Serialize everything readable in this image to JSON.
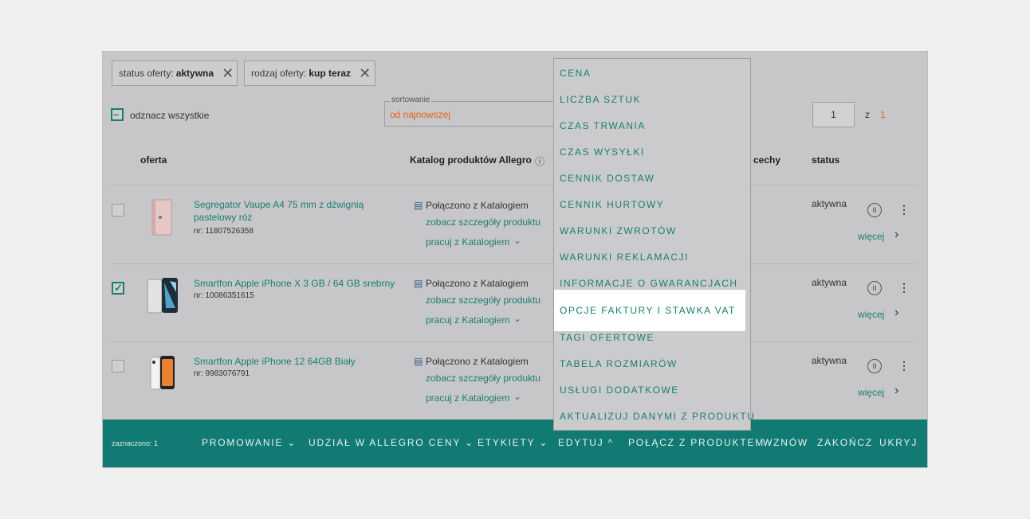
{
  "filters": [
    {
      "label": "status oferty:",
      "value": "aktywna"
    },
    {
      "label": "rodzaj oferty:",
      "value": "kup teraz"
    }
  ],
  "select_all_label": "odznacz wszystkie",
  "sort": {
    "label": "sortowanie",
    "value": "od najnowszej"
  },
  "pagination": {
    "current": "1",
    "of_label": "z",
    "total": "1"
  },
  "columns": {
    "offer": "oferta",
    "catalog": "Katalog produktów Allegro",
    "features": "cechy",
    "status": "status"
  },
  "offers": [
    {
      "title_line1": "Segregator Vaupe A4 75 mm z dźwignią",
      "title_line2": "pastelowy róż",
      "number": "nr: 11807526358",
      "catalog_status": "Połączono z Katalogiem",
      "details_link": "zobacz szczegóły produktu",
      "work_link": "pracuj z Katalogiem",
      "status": "aktywna",
      "more": "więcej",
      "checked": false
    },
    {
      "title_line1": "Smartfon Apple iPhone X 3 GB / 64 GB srebrny",
      "title_line2": "",
      "number": "nr: 10086351615",
      "catalog_status": "Połączono z Katalogiem",
      "details_link": "zobacz szczegóły produktu",
      "work_link": "pracuj z Katalogiem",
      "status": "aktywna",
      "more": "więcej",
      "checked": true
    },
    {
      "title_line1": "Smartfon Apple iPhone 12 64GB Biały",
      "title_line2": "",
      "number": "nr: 9983076791",
      "catalog_status": "Połączono z Katalogiem",
      "details_link": "zobacz szczegóły produktu",
      "work_link": "pracuj z Katalogiem",
      "status": "aktywna",
      "more": "więcej",
      "checked": false
    }
  ],
  "edit_menu": [
    "CENA",
    "LICZBA SZTUK",
    "CZAS TRWANIA",
    "CZAS WYSYŁKI",
    "CENNIK DOSTAW",
    "CENNIK HURTOWY",
    "WARUNKI ZWROTÓW",
    "WARUNKI REKLAMACJI",
    "INFORMACJE O GWARANCJACH",
    "OPCJE FAKTURY I STAWKA VAT",
    "TAGI OFERTOWE",
    "TABELA ROZMIARÓW",
    "USŁUGI DODATKOWE",
    "AKTUALIZUJ DANYMI Z PRODUKTU"
  ],
  "highlighted_item": "OPCJE FAKTURY I STAWKA VAT",
  "bottom_bar": {
    "selected_count": "zaznaczono: 1",
    "promote": "PROMOWANIE",
    "price_share": "UDZIAŁ W ALLEGRO CENY",
    "labels": "ETYKIETY",
    "edit": "EDYTUJ",
    "link_product": "POŁĄCZ Z PRODUKTEM",
    "resume": "WZNÓW",
    "end": "ZAKOŃCZ",
    "hide": "UKRYJ"
  },
  "colors": {
    "accent": "#1a7f6e",
    "bar": "#117a72",
    "sort_value": "#e4631c"
  }
}
